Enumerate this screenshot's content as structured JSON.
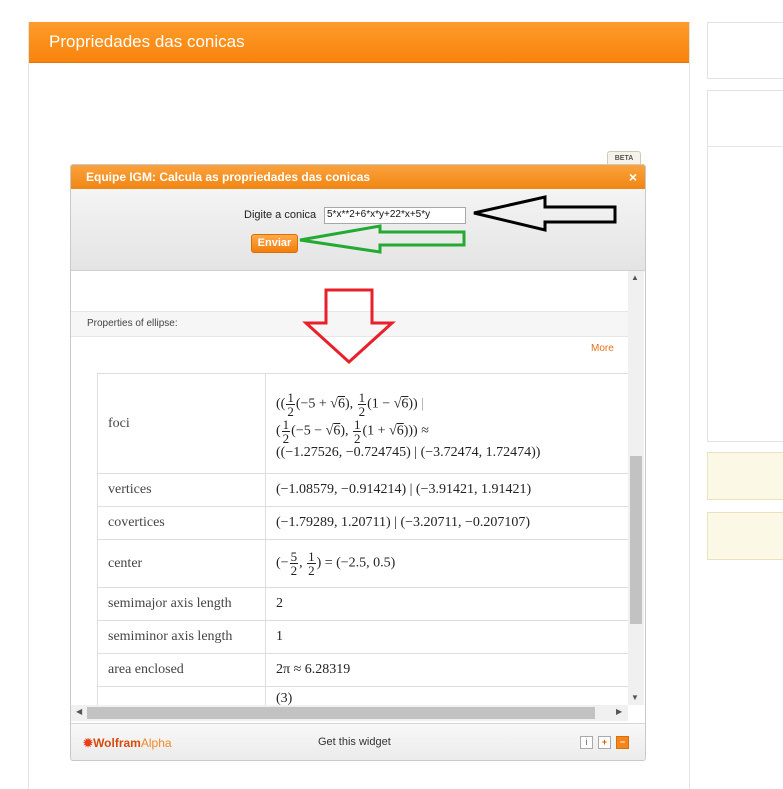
{
  "post": {
    "title": "Propriedades das conicas"
  },
  "widget": {
    "beta": "BETA",
    "title": "Equipe IGM: Calcula as propriedades das conicas",
    "close_icon": "×",
    "form": {
      "label": "Digite a conica",
      "input_value": "5*x**2+6*x*y+22*x+5*y",
      "submit_label": "Enviar"
    },
    "result": {
      "pod_title": "Properties of ellipse:",
      "more_label": "More",
      "rows": [
        {
          "key": "foci",
          "exact": "((1/2(−5 + √6), 1/2(1 − √6)) | (1/2(−5 − √6), 1/2(1 + √6))) ≈",
          "approx": "((−1.27526, −0.724745) | (−3.72474, 1.72474))"
        },
        {
          "key": "vertices",
          "value": "(−1.08579, −0.914214)  |  (−3.91421, 1.91421)"
        },
        {
          "key": "covertices",
          "value": "(−1.79289, 1.20711)  |  (−3.20711, −0.207107)"
        },
        {
          "key": "center",
          "value": "(−5/2, 1/2) = (−2.5, 0.5)"
        },
        {
          "key": "semimajor axis length",
          "value": "2"
        },
        {
          "key": "semiminor axis length",
          "value": "1"
        },
        {
          "key": "area enclosed",
          "value": "2π ≈ 6.28319"
        },
        {
          "key": "",
          "value": "(3)"
        }
      ]
    },
    "footer": {
      "logo_prefix": "Wolfram",
      "logo_suffix": "Alpha",
      "get_widget": "Get this widget",
      "info_icon": "i",
      "plus_icon": "+",
      "minus_icon": "−"
    }
  },
  "annotations": {
    "arrow_colors": {
      "black": "#000000",
      "green": "#22aa33",
      "red": "#e8202a"
    }
  }
}
